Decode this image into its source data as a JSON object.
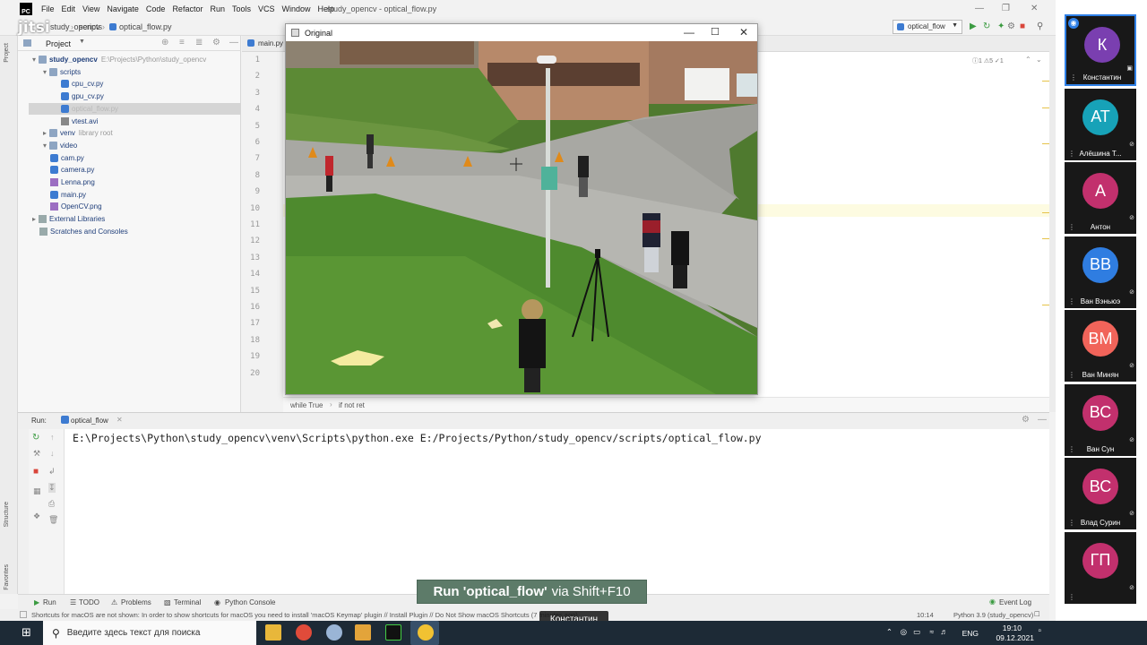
{
  "ide": {
    "menus": [
      "File",
      "Edit",
      "View",
      "Navigate",
      "Code",
      "Refactor",
      "Run",
      "Tools",
      "VCS",
      "Window",
      "Help"
    ],
    "doc_title": "study_opencv - optical_flow.py",
    "breadcrumb": [
      "study_opencv",
      "scripts",
      "optical_flow.py"
    ],
    "run_config": "optical_flow",
    "jitsi_logo": "jitsi",
    "editor_tab": "main.py",
    "problems_badge": "ⓘ1  ⚠5  ✓1",
    "editor_breadcrumb": [
      "while True",
      "if not ret"
    ],
    "line_numbers": [
      "1",
      "2",
      "3",
      "4",
      "5",
      "6",
      "7",
      "8",
      "9",
      "10",
      "11",
      "12",
      "13",
      "14",
      "15",
      "16",
      "17",
      "18",
      "19",
      "20"
    ]
  },
  "project_tree": {
    "header": "Project",
    "items": [
      {
        "label": "study_opencv",
        "extra": "E:\\Projects\\Python\\study_opencv",
        "icon": "folder",
        "indent": 0
      },
      {
        "label": "scripts",
        "extra": "",
        "icon": "folder",
        "indent": 1
      },
      {
        "label": "cpu_cv.py",
        "extra": "",
        "icon": "python-file",
        "indent": 2
      },
      {
        "label": "gpu_cv.py",
        "extra": "",
        "icon": "python-file",
        "indent": 2
      },
      {
        "label": "optical_flow.py",
        "extra": "",
        "icon": "python-file",
        "indent": 2
      },
      {
        "label": "vtest.avi",
        "extra": "",
        "icon": "video-file",
        "indent": 2
      },
      {
        "label": "venv",
        "extra": "library root",
        "icon": "folder",
        "indent": 1
      },
      {
        "label": "video",
        "extra": "",
        "icon": "folder",
        "indent": 1
      },
      {
        "label": "cam.py",
        "extra": "",
        "icon": "python-file",
        "indent": 1
      },
      {
        "label": "camera.py",
        "extra": "",
        "icon": "python-file",
        "indent": 1
      },
      {
        "label": "Lenna.png",
        "extra": "",
        "icon": "image-file",
        "indent": 1
      },
      {
        "label": "main.py",
        "extra": "",
        "icon": "python-file",
        "indent": 1
      },
      {
        "label": "OpenCV.png",
        "extra": "",
        "icon": "image-file",
        "indent": 1
      },
      {
        "label": "External Libraries",
        "extra": "",
        "icon": "library",
        "indent": 0
      },
      {
        "label": "Scratches and Consoles",
        "extra": "",
        "icon": "scratch",
        "indent": 0
      }
    ]
  },
  "cv_window": {
    "title": "Original"
  },
  "run_panel": {
    "label": "Run:",
    "tab": "optical_flow",
    "command": "E:\\Projects\\Python\\study_opencv\\venv\\Scripts\\python.exe E:/Projects/Python/study_opencv/scripts/optical_flow.py"
  },
  "tool_tabs": {
    "items": [
      "Run",
      "TODO",
      "Problems",
      "Terminal",
      "Python Console"
    ],
    "event_log": "Event Log",
    "side_labels": [
      "Project",
      "Structure",
      "Favorites"
    ]
  },
  "status_bar": {
    "message": "Shortcuts for macOS are not shown: In order to show shortcuts for macOS you need to install 'macOS Keymap' plugin // Install Plugin // Do Not Show macOS Shortcuts (7 minutes ago)",
    "position": "10:14",
    "interpreter": "Python 3.9 (study_opencv)"
  },
  "tooltip": {
    "bold": "Run 'optical_flow'",
    "rest": "via Shift+F10"
  },
  "speaker_label": "Константин",
  "taskbar": {
    "search_placeholder": "Введите здесь текст для поиска",
    "lang": "ENG",
    "time": "19:10",
    "date": "09.12.2021"
  },
  "participants": [
    {
      "initials": "К",
      "name": "Константин",
      "color": "#7a3fb0",
      "active": true
    },
    {
      "initials": "АТ",
      "name": "Алёшина Т...",
      "color": "#17a2b8",
      "active": false
    },
    {
      "initials": "А",
      "name": "Антон",
      "color": "#c2306d",
      "active": false
    },
    {
      "initials": "ВВ",
      "name": "Ван Вэньюэ",
      "color": "#2f7de1",
      "active": false
    },
    {
      "initials": "ВМ",
      "name": "Ван Минян",
      "color": "#f1645a",
      "active": false
    },
    {
      "initials": "ВС",
      "name": "Ван Сун",
      "color": "#c2306d",
      "active": false
    },
    {
      "initials": "ВС",
      "name": "Влад Сурин",
      "color": "#c2306d",
      "active": false
    },
    {
      "initials": "ГП",
      "name": "",
      "color": "#c2306d",
      "active": false
    }
  ]
}
